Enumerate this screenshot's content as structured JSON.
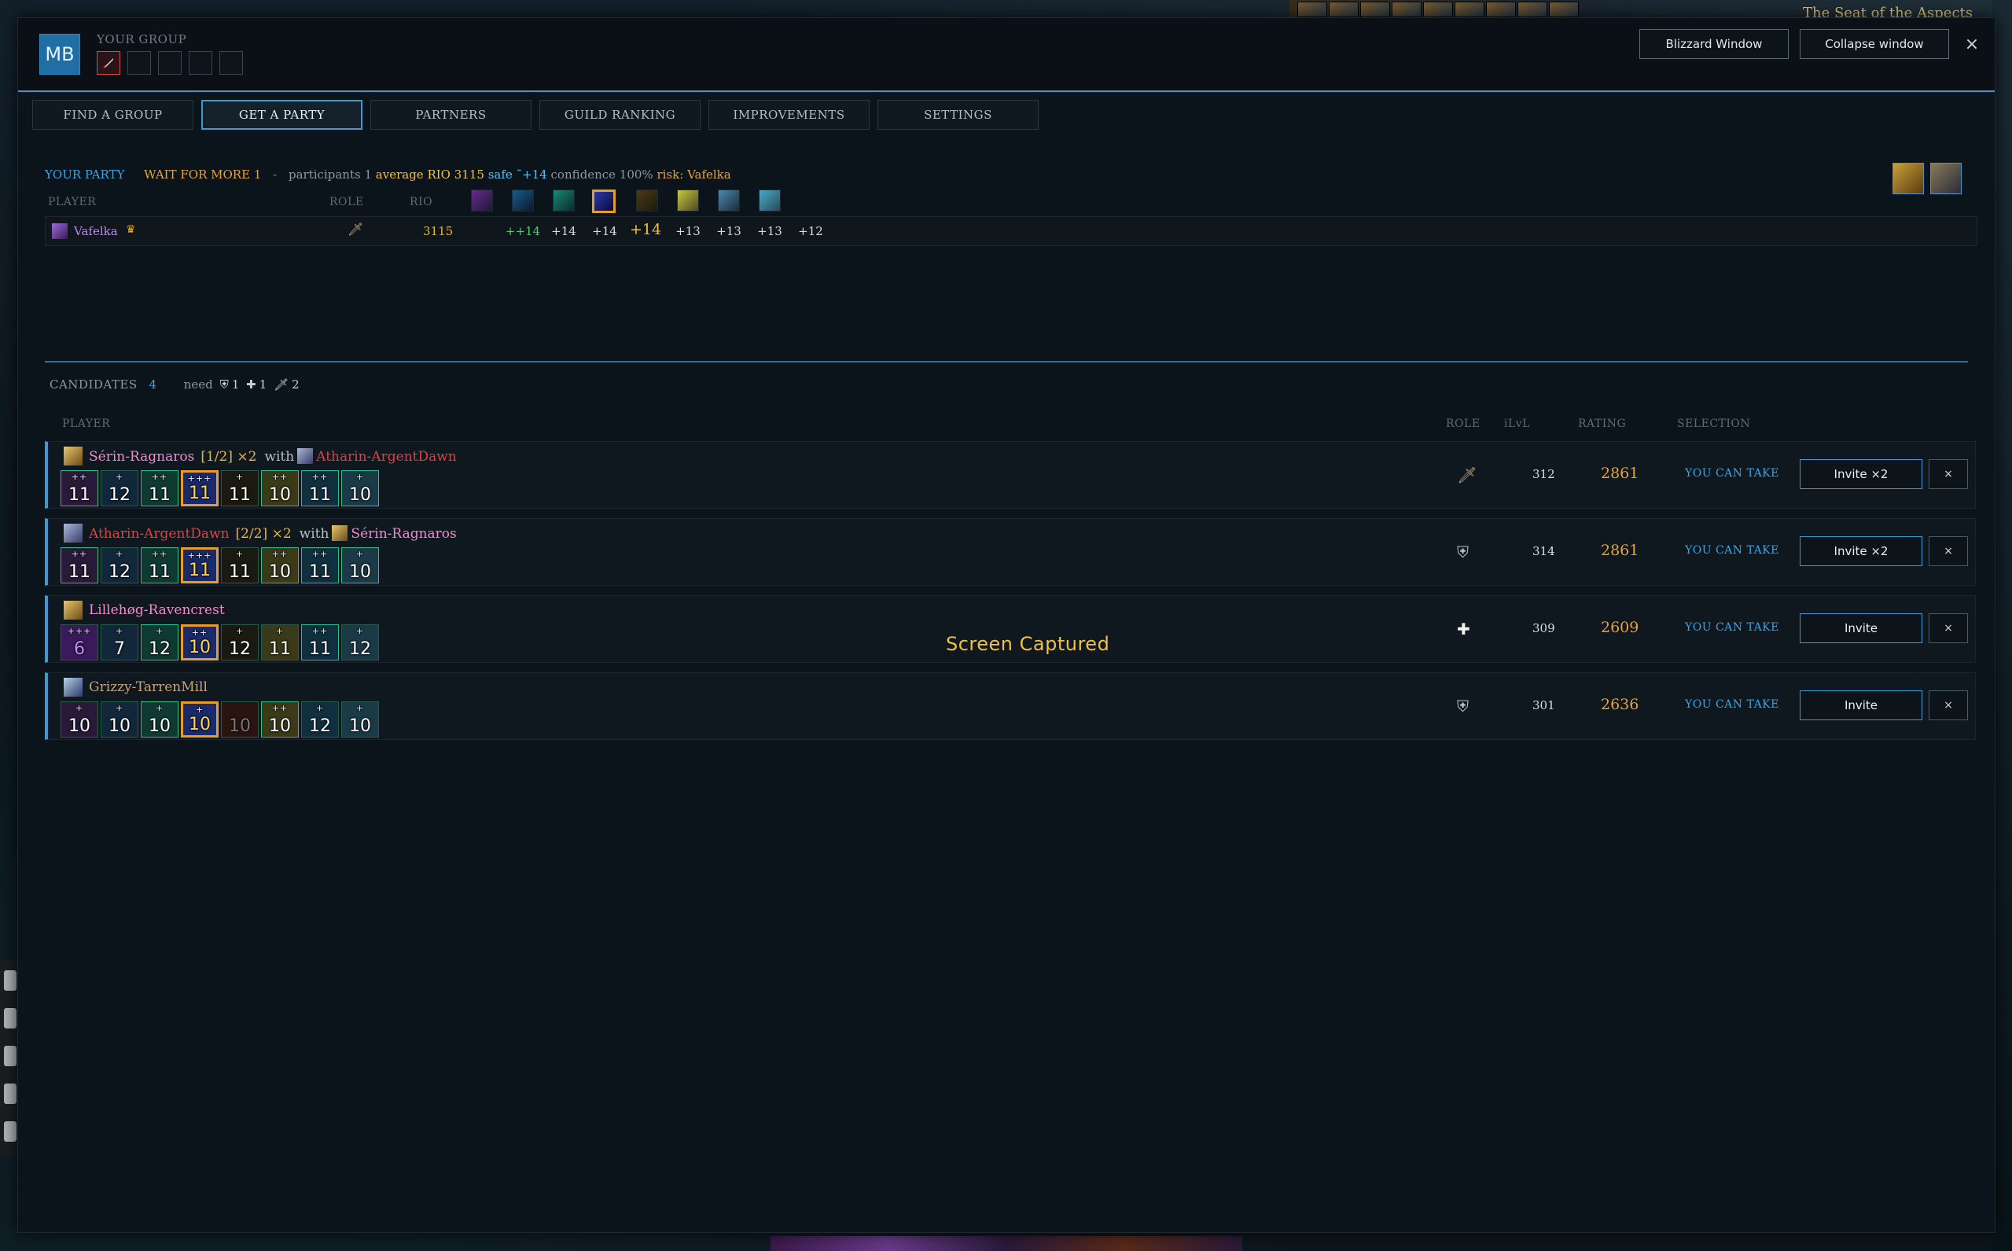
{
  "game_hud": {
    "zone_text": "The Seat of the Aspects"
  },
  "header": {
    "logo": "MB",
    "group_label": "YOUR GROUP",
    "blizzard_btn": "Blizzard Window",
    "collapse_btn": "Collapse window",
    "close": "×"
  },
  "tabs": [
    "FIND A GROUP",
    "GET A PARTY",
    "PARTNERS",
    "GUILD RANKING",
    "IMPROVEMENTS",
    "SETTINGS"
  ],
  "active_tab": "GET A PARTY",
  "party": {
    "title": "YOUR PARTY",
    "status": "WAIT FOR MORE",
    "count": "1",
    "sep": "-",
    "participants_label": "participants",
    "participants": "1",
    "average_label": "average RIO",
    "average": "3115",
    "safe_label": "safe",
    "safe_value": "˜+14",
    "confidence": "confidence 100%",
    "risk_label": "risk:",
    "risk_value": "Vafelka",
    "headers": {
      "player": "PLAYER",
      "role": "ROLE",
      "rio": "RIO"
    },
    "member": {
      "name": "Vafelka",
      "rio": "3115",
      "keys": [
        "++14",
        "+14",
        "+14",
        "+14",
        "+13",
        "+13",
        "+13",
        "+12"
      ]
    }
  },
  "candidates": {
    "label": "CANDIDATES",
    "count": "4",
    "need_label": "need",
    "need_tank": "1",
    "need_heal": "1",
    "need_dps": "2",
    "headers": {
      "player": "PLAYER",
      "role": "ROLE",
      "ilvl": "iLvL",
      "rating": "RATING",
      "selection": "SELECTION"
    },
    "rows": [
      {
        "name": "Sérin-Ragnaros",
        "counter": "[1/2] ×2",
        "with_label": "with",
        "with_name": "Atharin-ArgentDawn",
        "keys": [
          {
            "v": "11",
            "s": "++"
          },
          {
            "v": "12",
            "s": "+"
          },
          {
            "v": "11",
            "s": "++"
          },
          {
            "v": "11",
            "s": "+++"
          },
          {
            "v": "11",
            "s": "+"
          },
          {
            "v": "10",
            "s": "++"
          },
          {
            "v": "11",
            "s": "++"
          },
          {
            "v": "10",
            "s": "+"
          }
        ],
        "ilvl": "312",
        "rating": "2861",
        "selection": "YOU CAN TAKE",
        "invite": "Invite ×2",
        "reject": "×"
      },
      {
        "name": "Atharin-ArgentDawn",
        "counter": "[2/2] ×2",
        "with_label": "with",
        "with_name": "Sérin-Ragnaros",
        "keys": [
          {
            "v": "11",
            "s": "++"
          },
          {
            "v": "12",
            "s": "+"
          },
          {
            "v": "11",
            "s": "++"
          },
          {
            "v": "11",
            "s": "+++"
          },
          {
            "v": "11",
            "s": "+"
          },
          {
            "v": "10",
            "s": "++"
          },
          {
            "v": "11",
            "s": "++"
          },
          {
            "v": "10",
            "s": "+"
          }
        ],
        "ilvl": "314",
        "rating": "2861",
        "selection": "YOU CAN TAKE",
        "invite": "Invite ×2",
        "reject": "×"
      },
      {
        "name": "Lillehøg-Ravencrest",
        "keys": [
          {
            "v": "6",
            "s": "+++"
          },
          {
            "v": "7",
            "s": "+"
          },
          {
            "v": "12",
            "s": "+"
          },
          {
            "v": "10",
            "s": "++"
          },
          {
            "v": "12",
            "s": "+"
          },
          {
            "v": "11",
            "s": "+"
          },
          {
            "v": "11",
            "s": "++"
          },
          {
            "v": "12",
            "s": "+"
          }
        ],
        "ilvl": "309",
        "rating": "2609",
        "selection": "YOU CAN TAKE",
        "invite": "Invite",
        "reject": "×"
      },
      {
        "name": "Grizzy-TarrenMill",
        "keys": [
          {
            "v": "10",
            "s": "+"
          },
          {
            "v": "10",
            "s": "+"
          },
          {
            "v": "10",
            "s": "+"
          },
          {
            "v": "10",
            "s": "+"
          },
          {
            "v": "10",
            "s": ""
          },
          {
            "v": "10",
            "s": "++"
          },
          {
            "v": "12",
            "s": "+"
          },
          {
            "v": "10",
            "s": "+"
          }
        ],
        "ilvl": "301",
        "rating": "2636",
        "selection": "YOU CAN TAKE",
        "invite": "Invite",
        "reject": "×"
      }
    ]
  },
  "overlay": {
    "captured": "Screen Captured"
  },
  "colors": {
    "accent": "#3b9ad2",
    "gold": "#e9a23b",
    "highlight_key": "#e99c2a",
    "panel_bg": "#0c141b"
  }
}
